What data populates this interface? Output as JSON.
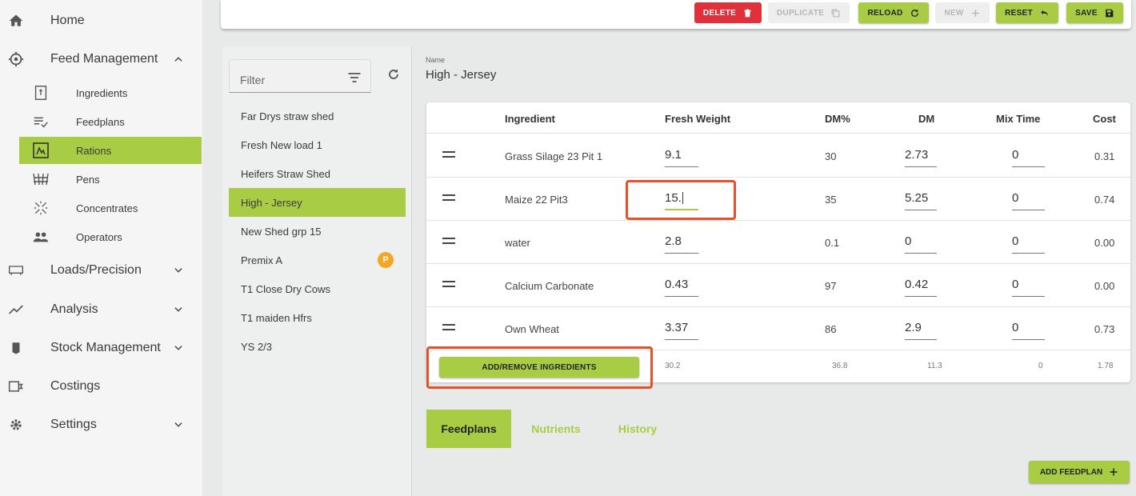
{
  "sidebar": {
    "home": "Home",
    "feed_management": "Feed Management",
    "sub_items": [
      "Ingredients",
      "Feedplans",
      "Rations",
      "Pens",
      "Concentrates",
      "Operators"
    ],
    "loads_precision": "Loads/Precision",
    "analysis": "Analysis",
    "stock_management": "Stock Management",
    "costings": "Costings",
    "settings": "Settings"
  },
  "toolbar": {
    "delete": "DELETE",
    "duplicate": "DUPLICATE",
    "reload": "RELOAD",
    "new": "NEW",
    "reset": "RESET",
    "save": "SAVE"
  },
  "list": {
    "filter_placeholder": "Filter",
    "rations": [
      {
        "name": "Far Drys straw shed"
      },
      {
        "name": "Fresh New load 1"
      },
      {
        "name": "Heifers Straw Shed"
      },
      {
        "name": "High - Jersey"
      },
      {
        "name": "New Shed grp 15"
      },
      {
        "name": "Premix A",
        "badge": "P"
      },
      {
        "name": "T1 Close Dry Cows"
      },
      {
        "name": "T1 maiden Hfrs"
      },
      {
        "name": "YS 2/3"
      }
    ]
  },
  "detail": {
    "name_caption": "Name",
    "name_value": "High - Jersey",
    "columns": [
      "Ingredient",
      "Fresh Weight",
      "DM%",
      "DM",
      "Mix Time",
      "Cost"
    ],
    "rows": [
      {
        "ingredient": "Grass Silage 23 Pit 1",
        "fresh_weight": "9.1",
        "dm_pct": "30",
        "dm": "2.73",
        "mix_time": "0",
        "cost": "0.31"
      },
      {
        "ingredient": "Maize 22 Pit3",
        "fresh_weight": "15.",
        "dm_pct": "35",
        "dm": "5.25",
        "mix_time": "0",
        "cost": "0.74"
      },
      {
        "ingredient": "water",
        "fresh_weight": "2.8",
        "dm_pct": "0.1",
        "dm": "0",
        "mix_time": "0",
        "cost": "0.00"
      },
      {
        "ingredient": "Calcium Carbonate",
        "fresh_weight": "0.43",
        "dm_pct": "97",
        "dm": "0.42",
        "mix_time": "0",
        "cost": "0.00"
      },
      {
        "ingredient": "Own Wheat",
        "fresh_weight": "3.37",
        "dm_pct": "86",
        "dm": "2.9",
        "mix_time": "0",
        "cost": "0.73"
      }
    ],
    "totals": {
      "fresh_weight": "30.2",
      "dm_pct": "36.8",
      "dm": "11.3",
      "mix_time": "0",
      "cost": "1.78"
    },
    "add_remove_label": "ADD/REMOVE INGREDIENTS",
    "tabs": [
      "Feedplans",
      "Nutrients",
      "History"
    ],
    "add_feedplan_label": "ADD FEEDPLAN"
  },
  "colors": {
    "accent": "#a9cc45",
    "danger": "#e0303a",
    "highlight": "#e8502a",
    "badge": "#f5a623"
  }
}
